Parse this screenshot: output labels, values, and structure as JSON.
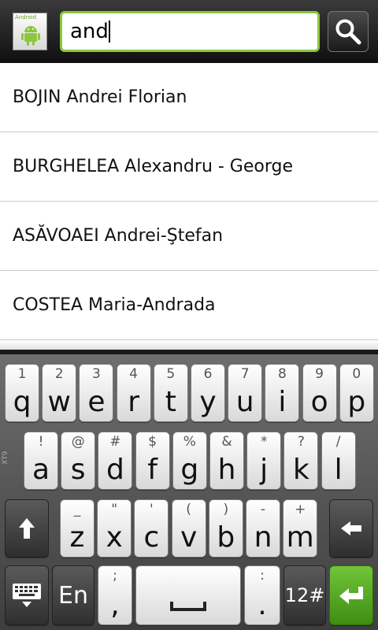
{
  "search": {
    "app_icon_label": "Android",
    "query": "and",
    "search_button_icon": "search-icon"
  },
  "results": [
    "BOJIN Andrei Florian",
    "BURGHELEA Alexandru - George",
    "ASĂVOAEI Andrei-Ştefan",
    "COSTEA Maria-Andrada"
  ],
  "keyboard": {
    "side_label": "XT9",
    "row1": [
      {
        "sub": "1",
        "main": "q"
      },
      {
        "sub": "2",
        "main": "w"
      },
      {
        "sub": "3",
        "main": "e"
      },
      {
        "sub": "4",
        "main": "r"
      },
      {
        "sub": "5",
        "main": "t"
      },
      {
        "sub": "6",
        "main": "y"
      },
      {
        "sub": "7",
        "main": "u"
      },
      {
        "sub": "8",
        "main": "i"
      },
      {
        "sub": "9",
        "main": "o"
      },
      {
        "sub": "0",
        "main": "p"
      }
    ],
    "row2": [
      {
        "sub": "!",
        "main": "a"
      },
      {
        "sub": "@",
        "main": "s"
      },
      {
        "sub": "#",
        "main": "d"
      },
      {
        "sub": "$",
        "main": "f"
      },
      {
        "sub": "%",
        "main": "g"
      },
      {
        "sub": "&",
        "main": "h"
      },
      {
        "sub": "*",
        "main": "j"
      },
      {
        "sub": "?",
        "main": "k"
      },
      {
        "sub": "/",
        "main": "l"
      }
    ],
    "row3": [
      {
        "sub": "_",
        "main": "z"
      },
      {
        "sub": "\"",
        "main": "x"
      },
      {
        "sub": "'",
        "main": "c"
      },
      {
        "sub": "(",
        "main": "v"
      },
      {
        "sub": ")",
        "main": "b"
      },
      {
        "sub": "-",
        "main": "n"
      },
      {
        "sub": "+",
        "main": "m"
      }
    ],
    "shift_icon": "shift-arrow-icon",
    "backspace_icon": "backspace-arrow-icon",
    "keyboard_icon": "keyboard-icon",
    "lang_label": "En",
    "comma_sub": ";",
    "comma_main": ",",
    "space_icon": "space-bar-icon",
    "period_sub": ":",
    "period_main": ".",
    "numbers_label": "12#",
    "enter_icon": "enter-arrow-icon",
    "enter_color": "#4fa31f"
  }
}
